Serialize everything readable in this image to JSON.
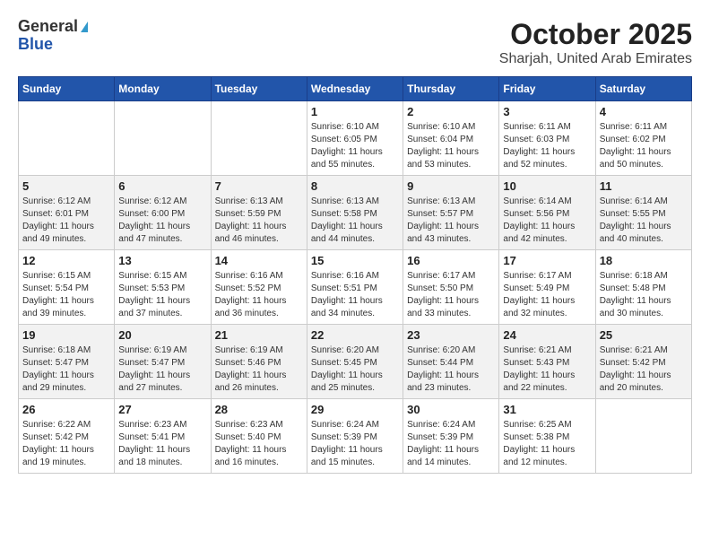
{
  "logo": {
    "general": "General",
    "blue": "Blue"
  },
  "header": {
    "title": "October 2025",
    "subtitle": "Sharjah, United Arab Emirates"
  },
  "weekdays": [
    "Sunday",
    "Monday",
    "Tuesday",
    "Wednesday",
    "Thursday",
    "Friday",
    "Saturday"
  ],
  "weeks": [
    [
      {
        "day": "",
        "info": ""
      },
      {
        "day": "",
        "info": ""
      },
      {
        "day": "",
        "info": ""
      },
      {
        "day": "1",
        "sunrise": "Sunrise: 6:10 AM",
        "sunset": "Sunset: 6:05 PM",
        "daylight": "Daylight: 11 hours and 55 minutes."
      },
      {
        "day": "2",
        "sunrise": "Sunrise: 6:10 AM",
        "sunset": "Sunset: 6:04 PM",
        "daylight": "Daylight: 11 hours and 53 minutes."
      },
      {
        "day": "3",
        "sunrise": "Sunrise: 6:11 AM",
        "sunset": "Sunset: 6:03 PM",
        "daylight": "Daylight: 11 hours and 52 minutes."
      },
      {
        "day": "4",
        "sunrise": "Sunrise: 6:11 AM",
        "sunset": "Sunset: 6:02 PM",
        "daylight": "Daylight: 11 hours and 50 minutes."
      }
    ],
    [
      {
        "day": "5",
        "sunrise": "Sunrise: 6:12 AM",
        "sunset": "Sunset: 6:01 PM",
        "daylight": "Daylight: 11 hours and 49 minutes."
      },
      {
        "day": "6",
        "sunrise": "Sunrise: 6:12 AM",
        "sunset": "Sunset: 6:00 PM",
        "daylight": "Daylight: 11 hours and 47 minutes."
      },
      {
        "day": "7",
        "sunrise": "Sunrise: 6:13 AM",
        "sunset": "Sunset: 5:59 PM",
        "daylight": "Daylight: 11 hours and 46 minutes."
      },
      {
        "day": "8",
        "sunrise": "Sunrise: 6:13 AM",
        "sunset": "Sunset: 5:58 PM",
        "daylight": "Daylight: 11 hours and 44 minutes."
      },
      {
        "day": "9",
        "sunrise": "Sunrise: 6:13 AM",
        "sunset": "Sunset: 5:57 PM",
        "daylight": "Daylight: 11 hours and 43 minutes."
      },
      {
        "day": "10",
        "sunrise": "Sunrise: 6:14 AM",
        "sunset": "Sunset: 5:56 PM",
        "daylight": "Daylight: 11 hours and 42 minutes."
      },
      {
        "day": "11",
        "sunrise": "Sunrise: 6:14 AM",
        "sunset": "Sunset: 5:55 PM",
        "daylight": "Daylight: 11 hours and 40 minutes."
      }
    ],
    [
      {
        "day": "12",
        "sunrise": "Sunrise: 6:15 AM",
        "sunset": "Sunset: 5:54 PM",
        "daylight": "Daylight: 11 hours and 39 minutes."
      },
      {
        "day": "13",
        "sunrise": "Sunrise: 6:15 AM",
        "sunset": "Sunset: 5:53 PM",
        "daylight": "Daylight: 11 hours and 37 minutes."
      },
      {
        "day": "14",
        "sunrise": "Sunrise: 6:16 AM",
        "sunset": "Sunset: 5:52 PM",
        "daylight": "Daylight: 11 hours and 36 minutes."
      },
      {
        "day": "15",
        "sunrise": "Sunrise: 6:16 AM",
        "sunset": "Sunset: 5:51 PM",
        "daylight": "Daylight: 11 hours and 34 minutes."
      },
      {
        "day": "16",
        "sunrise": "Sunrise: 6:17 AM",
        "sunset": "Sunset: 5:50 PM",
        "daylight": "Daylight: 11 hours and 33 minutes."
      },
      {
        "day": "17",
        "sunrise": "Sunrise: 6:17 AM",
        "sunset": "Sunset: 5:49 PM",
        "daylight": "Daylight: 11 hours and 32 minutes."
      },
      {
        "day": "18",
        "sunrise": "Sunrise: 6:18 AM",
        "sunset": "Sunset: 5:48 PM",
        "daylight": "Daylight: 11 hours and 30 minutes."
      }
    ],
    [
      {
        "day": "19",
        "sunrise": "Sunrise: 6:18 AM",
        "sunset": "Sunset: 5:47 PM",
        "daylight": "Daylight: 11 hours and 29 minutes."
      },
      {
        "day": "20",
        "sunrise": "Sunrise: 6:19 AM",
        "sunset": "Sunset: 5:47 PM",
        "daylight": "Daylight: 11 hours and 27 minutes."
      },
      {
        "day": "21",
        "sunrise": "Sunrise: 6:19 AM",
        "sunset": "Sunset: 5:46 PM",
        "daylight": "Daylight: 11 hours and 26 minutes."
      },
      {
        "day": "22",
        "sunrise": "Sunrise: 6:20 AM",
        "sunset": "Sunset: 5:45 PM",
        "daylight": "Daylight: 11 hours and 25 minutes."
      },
      {
        "day": "23",
        "sunrise": "Sunrise: 6:20 AM",
        "sunset": "Sunset: 5:44 PM",
        "daylight": "Daylight: 11 hours and 23 minutes."
      },
      {
        "day": "24",
        "sunrise": "Sunrise: 6:21 AM",
        "sunset": "Sunset: 5:43 PM",
        "daylight": "Daylight: 11 hours and 22 minutes."
      },
      {
        "day": "25",
        "sunrise": "Sunrise: 6:21 AM",
        "sunset": "Sunset: 5:42 PM",
        "daylight": "Daylight: 11 hours and 20 minutes."
      }
    ],
    [
      {
        "day": "26",
        "sunrise": "Sunrise: 6:22 AM",
        "sunset": "Sunset: 5:42 PM",
        "daylight": "Daylight: 11 hours and 19 minutes."
      },
      {
        "day": "27",
        "sunrise": "Sunrise: 6:23 AM",
        "sunset": "Sunset: 5:41 PM",
        "daylight": "Daylight: 11 hours and 18 minutes."
      },
      {
        "day": "28",
        "sunrise": "Sunrise: 6:23 AM",
        "sunset": "Sunset: 5:40 PM",
        "daylight": "Daylight: 11 hours and 16 minutes."
      },
      {
        "day": "29",
        "sunrise": "Sunrise: 6:24 AM",
        "sunset": "Sunset: 5:39 PM",
        "daylight": "Daylight: 11 hours and 15 minutes."
      },
      {
        "day": "30",
        "sunrise": "Sunrise: 6:24 AM",
        "sunset": "Sunset: 5:39 PM",
        "daylight": "Daylight: 11 hours and 14 minutes."
      },
      {
        "day": "31",
        "sunrise": "Sunrise: 6:25 AM",
        "sunset": "Sunset: 5:38 PM",
        "daylight": "Daylight: 11 hours and 12 minutes."
      },
      {
        "day": "",
        "info": ""
      }
    ]
  ]
}
